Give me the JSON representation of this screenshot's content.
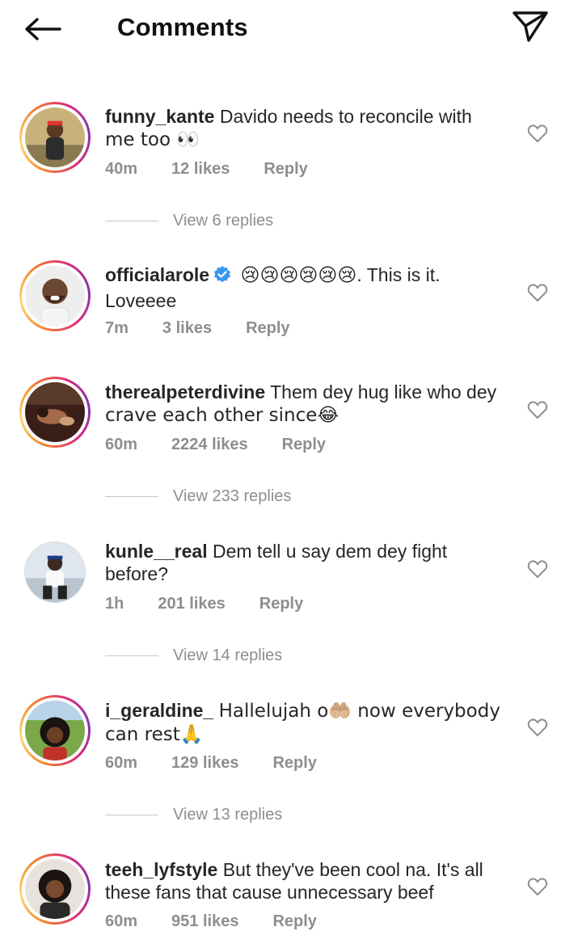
{
  "header": {
    "title": "Comments",
    "back_icon": "arrow-left-icon",
    "send_icon": "paper-plane-icon"
  },
  "colors": {
    "text": "#262626",
    "muted": "#8e8e8e",
    "verified": "#3897f0"
  },
  "comments": [
    {
      "username": "funny_kante",
      "text_line1": "Davido needs to reconcile with",
      "text_line2": "me too 👀",
      "time": "40m",
      "likes": "12 likes",
      "reply": "Reply",
      "view_replies": "View 6 replies"
    },
    {
      "username": "officialarole",
      "verified": true,
      "emojis": "😢😢😢😢😢😢",
      "text_line1": ". This is it.",
      "text_line2": "Loveeee",
      "time": "7m",
      "likes": "3 likes",
      "reply": "Reply"
    },
    {
      "username": "therealpeterdivine",
      "text_line1": "Them dey hug like who dey",
      "text_line2": "crave each other since😂",
      "time": "60m",
      "likes": "2224 likes",
      "reply": "Reply",
      "view_replies": "View 233 replies"
    },
    {
      "username": "kunle__real",
      "text_line1": "Dem tell u say dem dey fight",
      "text_line2": "before?",
      "time": "1h",
      "likes": "201 likes",
      "reply": "Reply",
      "view_replies": "View 14 replies"
    },
    {
      "username": "i_geraldine_",
      "text_line1": "Hallelujah o🤲🏼 now everybody",
      "text_line2": "can rest🙏",
      "time": "60m",
      "likes": "129 likes",
      "reply": "Reply",
      "view_replies": "View 13 replies"
    },
    {
      "username": "teeh_lyfstyle",
      "text_line1": "But they've been cool na. It's all",
      "text_line2": "these fans that cause unnecessary beef",
      "time": "60m",
      "likes": "951 likes",
      "reply": "Reply"
    }
  ]
}
